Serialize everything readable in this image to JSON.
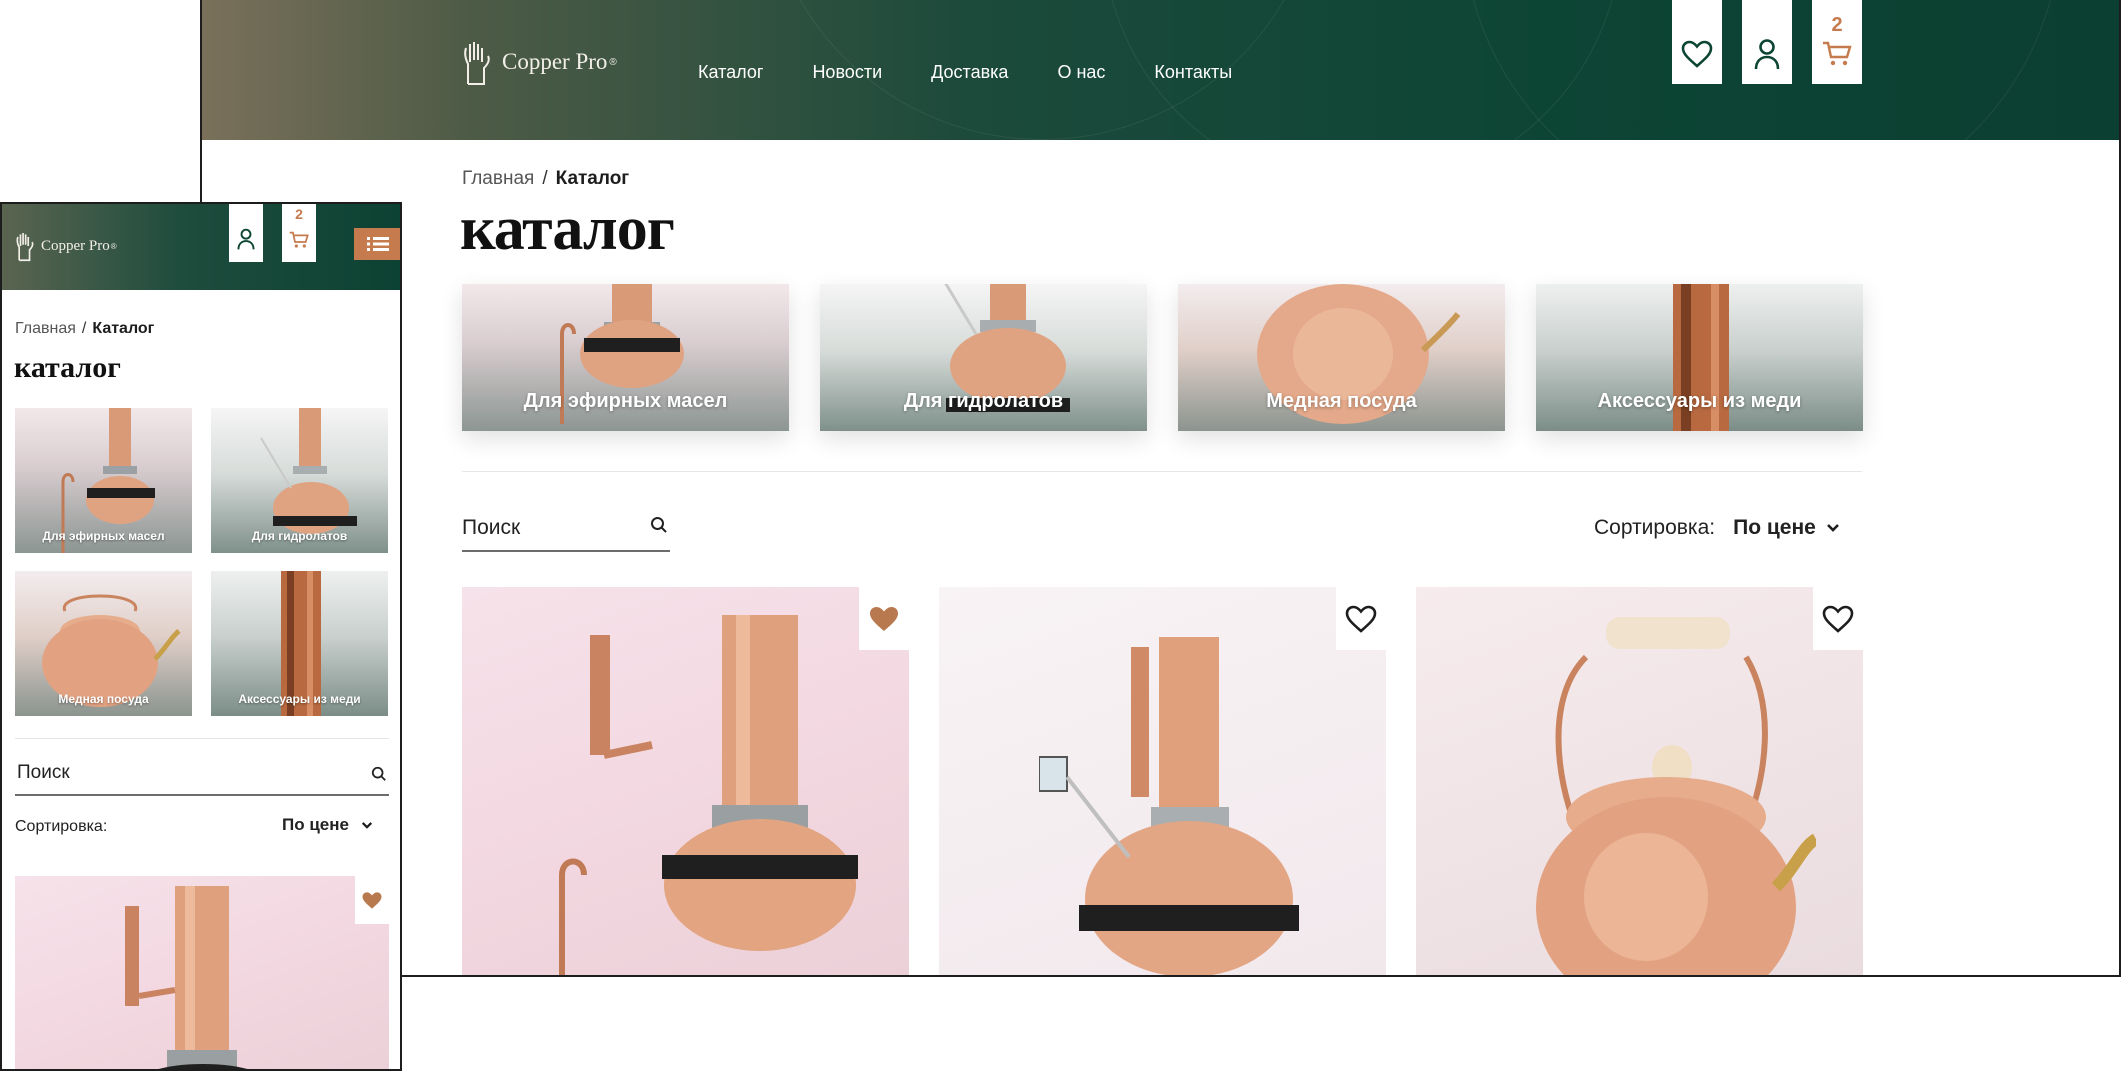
{
  "brand": {
    "name": "Copper Pro",
    "reg": "®"
  },
  "nav": {
    "items": [
      {
        "label": "Каталог"
      },
      {
        "label": "Новости"
      },
      {
        "label": "Доставка"
      },
      {
        "label": "О нас"
      },
      {
        "label": "Контакты"
      }
    ]
  },
  "header_icons": {
    "favorites": "heart-icon",
    "account": "user-icon",
    "cart": "cart-icon",
    "cart_count": "2",
    "menu": "list-menu-icon"
  },
  "breadcrumb": {
    "home": "Главная",
    "separator": "/",
    "current": "Каталог"
  },
  "page_title": "каталог",
  "categories": [
    {
      "label": "Для эфирных масел"
    },
    {
      "label": "Для гидролатов"
    },
    {
      "label": "Медная посуда"
    },
    {
      "label": "Аксессуары из меди"
    }
  ],
  "search": {
    "placeholder": "Поиск"
  },
  "sort": {
    "label": "Сортировка:",
    "value": "По цене"
  },
  "products": [
    {
      "image": "copper-distiller-with-column",
      "favorite": true
    },
    {
      "image": "copper-distiller-with-thermometer",
      "favorite": false
    },
    {
      "image": "copper-kettle",
      "favorite": false
    }
  ],
  "colors": {
    "accent_copper": "#c57b4e",
    "header_green": "#0d4535",
    "text_dark": "#1d1d1d"
  }
}
